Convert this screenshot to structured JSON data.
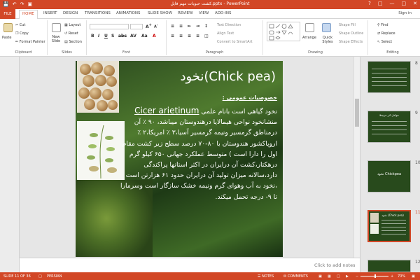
{
  "window": {
    "title": "ﮐﺸﺖ ﺣﺒﻮﺑﺎت ﻣﻬﻢ ﻓﺎﻳﻞ.pptx - PowerPoint",
    "quick_access": [
      "save-icon",
      "undo-icon",
      "redo-icon",
      "present-icon"
    ],
    "controls": [
      "help-icon",
      "restore-ribbon-icon",
      "minimize-icon",
      "maximize-icon",
      "close-icon"
    ],
    "accent": "#d24726"
  },
  "tabs": [
    "FILE",
    "HOME",
    "INSERT",
    "DESIGN",
    "TRANSITIONS",
    "ANIMATIONS",
    "SLIDE SHOW",
    "REVIEW",
    "VIEW",
    "ADD-INS"
  ],
  "active_tab": "HOME",
  "signin": "Sign in",
  "ribbon": {
    "clipboard": {
      "label": "Clipboard",
      "paste": "Paste",
      "cut": "Cut",
      "copy": "Copy",
      "format_painter": "Format Painter"
    },
    "slides": {
      "label": "Slides",
      "new_slide": "New Slide",
      "layout": "Layout",
      "reset": "Reset",
      "section": "Section"
    },
    "font": {
      "label": "Font"
    },
    "paragraph": {
      "label": "Paragraph",
      "text_direction": "Text Direction",
      "align_text": "Align Text",
      "convert_smartart": "Convert to SmartArt"
    },
    "drawing": {
      "label": "Drawing",
      "arrange": "Arrange",
      "quick_styles": "Quick Styles",
      "shape_fill": "Shape Fill",
      "shape_outline": "Shape Outline",
      "shape_effects": "Shape Effects"
    },
    "editing": {
      "label": "Editing",
      "find": "Find",
      "replace": "Replace",
      "select": "Select"
    }
  },
  "slide": {
    "title": "(Chick pea)نخود",
    "subheading": "خصوصیات عمومی :",
    "body_before_latin": "نخود گیاهی است بانام علمی ",
    "latin_name": "Cicer arietinum",
    "body_after_latin": " منشانخود نواحی هیمالایا درهندوستان میباشد، ۹۰ ٪ آن درمناطق گرمسیر ونیمه گرمسیر آسیا،۳ ٪ امریکا،۲ ٪ اروپاکشور هندوستان با ۸۰-۷۰ درصد سطح زیر کشت مقام اول را دارا است ) متوسط عملکرد جهانی ۶۵۰ کیلو گرم درهکتار،کشت آن درایران در اکثر استانها پراکندگی دارد،سالانه میزان تولید آن درایران حدود ۶۱ هزارتن است ،نخود به آب وهوای گرم ونیمه خشک سازگار است وسرمارا تا ۹- درجه تحمل میکند."
  },
  "thumbnails": [
    {
      "num": "8",
      "title": "",
      "selected": false
    },
    {
      "num": "9",
      "title": "عوامل اثر مرتبط",
      "selected": false
    },
    {
      "num": "10",
      "title": "نخود Chickpea",
      "selected": false
    },
    {
      "num": "11",
      "title": "نخود (Chick pea)",
      "selected": true
    },
    {
      "num": "12",
      "title": "",
      "selected": false
    }
  ],
  "notes_placeholder": "Click to add notes",
  "status": {
    "slide_counter": "SLIDE 11 OF 36",
    "language": "PERSIAN",
    "notes": "NOTES",
    "comments": "COMMENTS",
    "zoom": "70%"
  }
}
